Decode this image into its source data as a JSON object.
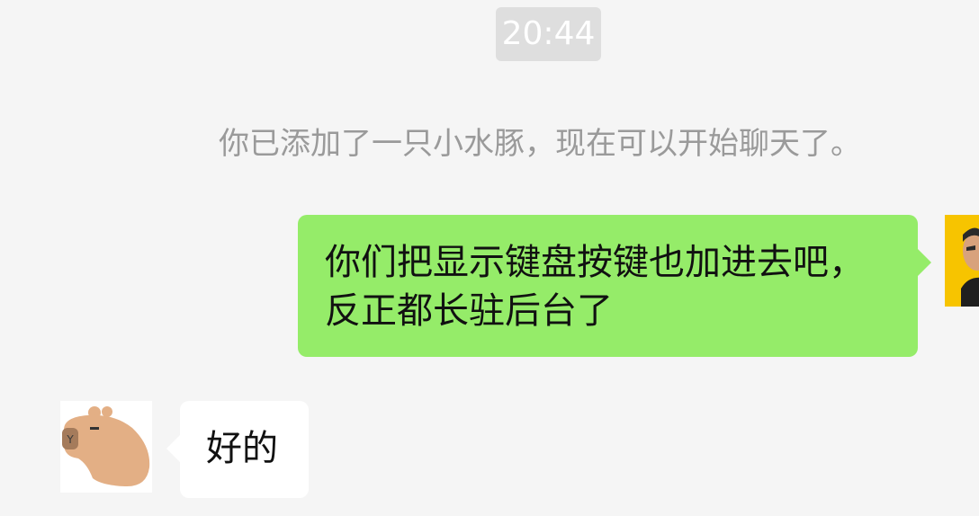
{
  "chat": {
    "timestamp": "20:44",
    "system_note": "你已添加了一只小水豚，现在可以开始聊天了。",
    "messages": [
      {
        "sender": "self",
        "lines": [
          "你们把显示键盘按键也加进去吧，",
          "反正都长驻后台了"
        ],
        "avatar_icon": "user-photo-icon"
      },
      {
        "sender": "other",
        "lines": [
          "好的"
        ],
        "avatar_icon": "capybara-avatar-icon"
      }
    ]
  },
  "colors": {
    "background": "#f5f5f5",
    "outgoing_bubble": "#95ec69",
    "incoming_bubble": "#ffffff",
    "timestamp_badge": "#dedede",
    "system_text": "#9a9a9a",
    "avatar_self_bg": "#f7c400",
    "capybara": "#e3af85"
  }
}
